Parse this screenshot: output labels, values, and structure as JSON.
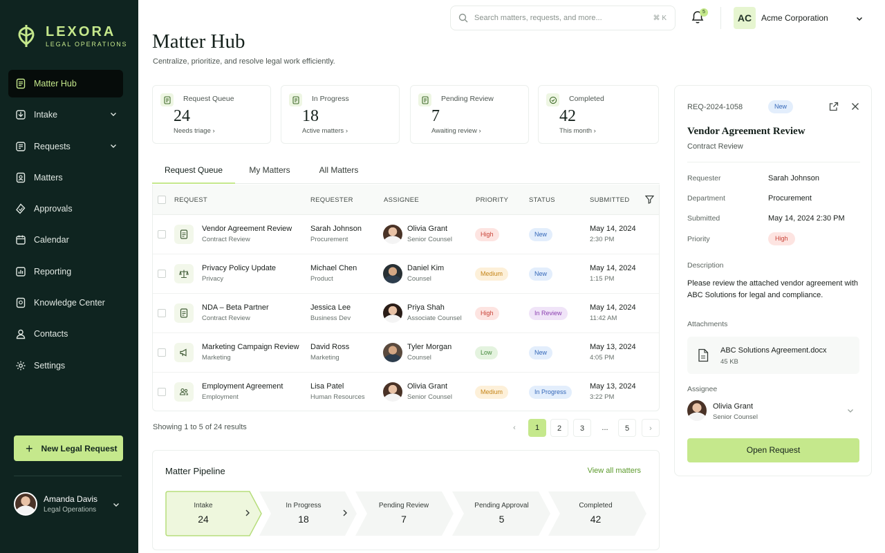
{
  "brand": {
    "name": "LEXORA",
    "tagline": "LEGAL OPERATIONS",
    "accent": "#c5e88c",
    "sidebar_bg": "#0f2420"
  },
  "sidebar": {
    "items": [
      {
        "label": "Matter Hub",
        "icon": "document-icon",
        "active": true
      },
      {
        "label": "Intake",
        "icon": "inbox-icon",
        "expandable": true
      },
      {
        "label": "Requests",
        "icon": "requests-icon",
        "expandable": true
      },
      {
        "label": "Matters",
        "icon": "briefcase-icon"
      },
      {
        "label": "Approvals",
        "icon": "approval-icon"
      },
      {
        "label": "Calendar",
        "icon": "calendar-icon"
      },
      {
        "label": "Reporting",
        "icon": "chart-icon"
      },
      {
        "label": "Knowledge Center",
        "icon": "book-icon"
      },
      {
        "label": "Contacts",
        "icon": "contacts-icon"
      },
      {
        "label": "Settings",
        "icon": "gear-icon"
      }
    ],
    "new_request_label": "New Legal Request",
    "user": {
      "name": "Amanda Davis",
      "role": "Legal Operations"
    }
  },
  "topbar": {
    "search_placeholder": "Search matters, requests, and more...",
    "shortcut": "⌘ K",
    "notification_count": "5",
    "org_initials": "AC",
    "org_name": "Acme Corporation"
  },
  "header": {
    "title": "Matter Hub",
    "subtitle": "Centralize, prioritize, and resolve legal work efficiently."
  },
  "stats": [
    {
      "label": "Request Queue",
      "value": "24",
      "footer": "Needs triage"
    },
    {
      "label": "In Progress",
      "value": "18",
      "footer": "Active matters"
    },
    {
      "label": "Pending Review",
      "value": "7",
      "footer": "Awaiting review"
    },
    {
      "label": "Completed",
      "value": "42",
      "footer": "This month"
    }
  ],
  "tabs": [
    "Request Queue",
    "My Matters",
    "All Matters"
  ],
  "table": {
    "columns": [
      "REQUEST",
      "REQUESTER",
      "ASSIGNEE",
      "PRIORITY",
      "STATUS",
      "SUBMITTED"
    ],
    "rows": [
      {
        "title": "Vendor Agreement Review",
        "type": "Contract Review",
        "requester": "Sarah Johnson",
        "dept": "Procurement",
        "assignee": "Olivia Grant",
        "assignee_role": "Senior Counsel",
        "priority": "High",
        "status": "New",
        "date": "May 14, 2024",
        "time": "2:30 PM"
      },
      {
        "title": "Privacy Policy Update",
        "type": "Privacy",
        "requester": "Michael Chen",
        "dept": "Product",
        "assignee": "Daniel Kim",
        "assignee_role": "Counsel",
        "priority": "Medium",
        "status": "New",
        "date": "May 14, 2024",
        "time": "1:15 PM"
      },
      {
        "title": "NDA – Beta Partner",
        "type": "Contract Review",
        "requester": "Jessica Lee",
        "dept": "Business Dev",
        "assignee": "Priya Shah",
        "assignee_role": "Associate Counsel",
        "priority": "High",
        "status": "In Review",
        "date": "May 14, 2024",
        "time": "11:42 AM"
      },
      {
        "title": "Marketing Campaign Review",
        "type": "Marketing",
        "requester": "David Ross",
        "dept": "Marketing",
        "assignee": "Tyler Morgan",
        "assignee_role": "Counsel",
        "priority": "Low",
        "status": "New",
        "date": "May 13, 2024",
        "time": "4:05 PM"
      },
      {
        "title": "Employment Agreement",
        "type": "Employment",
        "requester": "Lisa Patel",
        "dept": "Human Resources",
        "assignee": "Olivia Grant",
        "assignee_role": "Senior Counsel",
        "priority": "Medium",
        "status": "In Progress",
        "date": "May 13, 2024",
        "time": "3:22 PM"
      }
    ],
    "showing": "Showing 1 to 5 of 24 results",
    "pages": [
      "1",
      "2",
      "3",
      "...",
      "5"
    ],
    "current_page": "1"
  },
  "pipeline": {
    "title": "Matter Pipeline",
    "link": "View all matters",
    "stages": [
      {
        "label": "Intake",
        "value": "24"
      },
      {
        "label": "In Progress",
        "value": "18"
      },
      {
        "label": "Pending Review",
        "value": "7"
      },
      {
        "label": "Pending Approval",
        "value": "5"
      },
      {
        "label": "Completed",
        "value": "42"
      }
    ]
  },
  "detail": {
    "id": "REQ-2024-1058",
    "badge": "New",
    "title": "Vendor Agreement Review",
    "subtitle": "Contract Review",
    "fields": [
      {
        "key": "Requester",
        "value": "Sarah Johnson"
      },
      {
        "key": "Department",
        "value": "Procurement"
      },
      {
        "key": "Submitted",
        "value": "May 14, 2024 2:30 PM"
      },
      {
        "key": "Priority",
        "value": "High"
      }
    ],
    "description_label": "Description",
    "description": "Please review the attached vendor agreement with ABC Solutions for legal and compliance.",
    "attachments_label": "Attachments",
    "attachment": {
      "name": "ABC Solutions Agreement.docx",
      "size": "45 KB"
    },
    "assignee_label": "Assignee",
    "assignee": {
      "name": "Olivia Grant",
      "role": "Senior Counsel"
    },
    "open_label": "Open Request"
  }
}
